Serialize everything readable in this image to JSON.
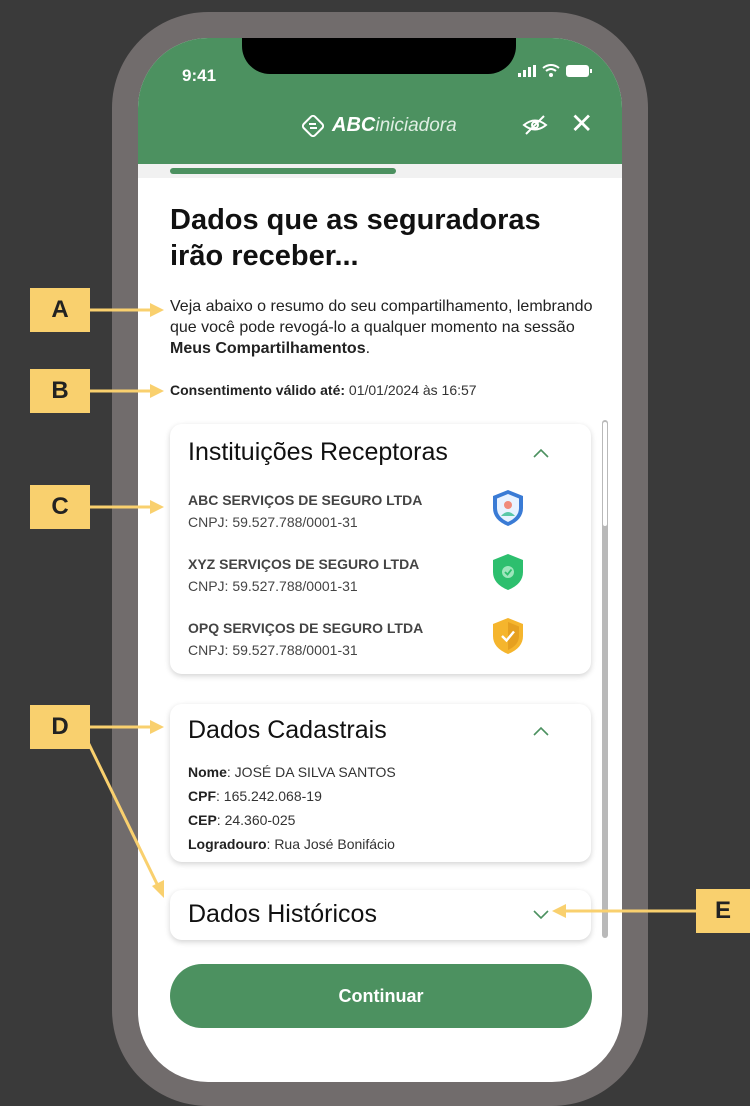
{
  "status_bar": {
    "time": "9:41"
  },
  "header": {
    "brand_strong": "ABC",
    "brand_light": "iniciadora"
  },
  "page": {
    "title": "Dados que as seguradoras irão receber...",
    "intro_prefix": "Veja abaixo o resumo do seu compartilhamento, lembrando que você pode revogá-lo a qualquer momento na sessão ",
    "intro_bold": "Meus Compartilhamentos",
    "intro_suffix": ".",
    "validity_label": "Consentimento válido até:",
    "validity_value": "01/01/2024 às 16:57"
  },
  "institutions": {
    "title": "Instituições Receptoras",
    "items": [
      {
        "name": "ABC SERVIÇOS DE SEGURO LTDA",
        "cnpj": "CNPJ: 59.527.788/0001-31",
        "icon": "blue-shield-icon",
        "color": "#3a7bd5"
      },
      {
        "name": "XYZ SERVIÇOS DE SEGURO LTDA",
        "cnpj": "CNPJ: 59.527.788/0001-31",
        "icon": "green-shield-icon",
        "color": "#2dbf6e"
      },
      {
        "name": "OPQ SERVIÇOS DE SEGURO LTDA",
        "cnpj": "CNPJ: 59.527.788/0001-31",
        "icon": "yellow-shield-icon",
        "color": "#f5b52d"
      }
    ]
  },
  "cadastrais": {
    "title": "Dados Cadastrais",
    "fields": [
      {
        "label": "Nome",
        "value": ": JOSÉ DA SILVA SANTOS"
      },
      {
        "label": "CPF",
        "value": ": 165.242.068-19"
      },
      {
        "label": "CEP",
        "value": ": 24.360-025"
      },
      {
        "label": "Logradouro",
        "value": ": Rua José Bonifácio"
      }
    ]
  },
  "historicos": {
    "title": "Dados Históricos"
  },
  "continue_label": "Continuar",
  "callouts": [
    "A",
    "B",
    "C",
    "D",
    "E"
  ],
  "colors": {
    "primary_green": "#4c9160",
    "callout_yellow": "#f9d06e",
    "frame_gray": "#716c6c",
    "background": "#3a3a3a"
  }
}
